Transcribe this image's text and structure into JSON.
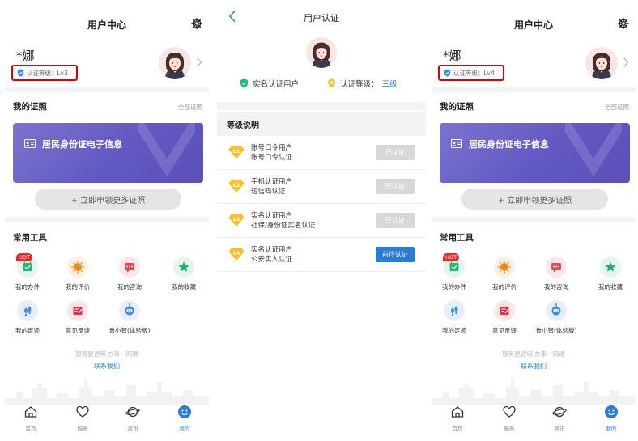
{
  "user_center": {
    "title": "用户中心",
    "username": "*娜",
    "my_certs": "我的证照",
    "all_certs": "全部证照",
    "id_card_text": "居民身份证电子信息",
    "apply_more": "+ 立即申领更多证照",
    "common_tools": "常用工具",
    "hot_badge": "HOT",
    "tools": [
      {
        "label": "我的办件",
        "icon": "calendar-check-icon",
        "color": "#21b97a"
      },
      {
        "label": "我的评价",
        "icon": "thumbs-up-icon",
        "color": "#f08a1c"
      },
      {
        "label": "我的咨询",
        "icon": "chat-bubble-icon",
        "color": "#e24a5a"
      },
      {
        "label": "我的收藏",
        "icon": "star-icon",
        "color": "#1db36b"
      },
      {
        "label": "我的足迹",
        "icon": "footprint-icon",
        "color": "#3e8ee8"
      },
      {
        "label": "意见反馈",
        "icon": "feedback-icon",
        "color": "#e2304a"
      },
      {
        "label": "鲁小智(体验版)",
        "icon": "robot-icon",
        "color": "#3e8ee8"
      }
    ],
    "slogan": "服务更透明 办事一网通",
    "contact": "联系我们",
    "tabs": [
      "首页",
      "服务",
      "资讯",
      "我的"
    ]
  },
  "left_panel": {
    "level_label": "认证等级：Lv3"
  },
  "right_panel": {
    "level_label": "认证等级：Lv4"
  },
  "auth_page": {
    "title": "用户认证",
    "real_name_user": "实名认证用户",
    "level_prefix": "认证等级：",
    "level_value": "三级",
    "level_desc_title": "等级说明",
    "levels": [
      {
        "badge": "L1",
        "line1": "账号口令用户",
        "line2": "账号口令认证",
        "button": "已认证",
        "status": "done"
      },
      {
        "badge": "L2",
        "line1": "手机认证用户",
        "line2": "短信码认证",
        "button": "已认证",
        "status": "done"
      },
      {
        "badge": "L3",
        "line1": "实名认证用户",
        "line2": "社保/身份证实名认证",
        "button": "已认证",
        "status": "done"
      },
      {
        "badge": "L4",
        "line1": "实名认证用户",
        "line2": "公安实人认证",
        "button": "前往认证",
        "status": "go"
      }
    ]
  },
  "colors": {
    "accent": "#2a7cd6",
    "card": "#6259c2",
    "highlight": "#e00000",
    "badge_gold": "#f2c230"
  }
}
